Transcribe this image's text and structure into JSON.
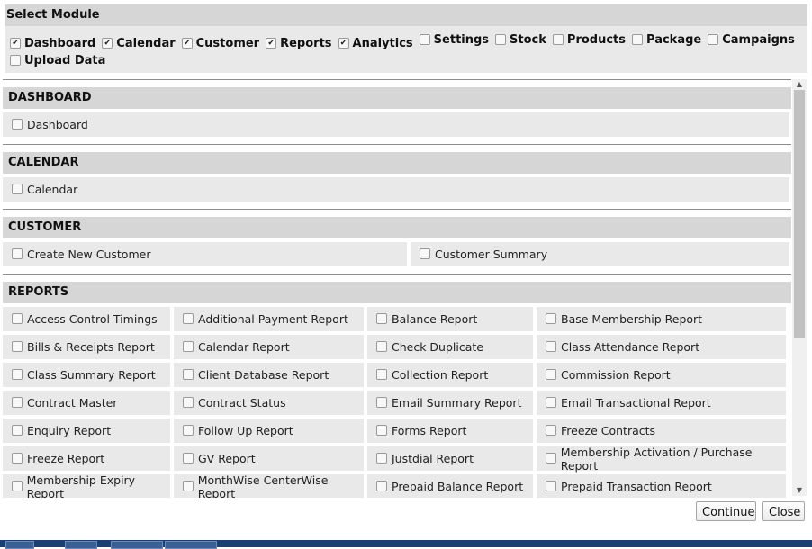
{
  "module_panel": {
    "title": "Select Module",
    "options": [
      {
        "label": "Dashboard",
        "checked": true
      },
      {
        "label": "Calendar",
        "checked": true
      },
      {
        "label": "Customer",
        "checked": true
      },
      {
        "label": "Reports",
        "checked": true
      },
      {
        "label": "Analytics",
        "checked": true
      },
      {
        "label": "Settings",
        "checked": false
      },
      {
        "label": "Stock",
        "checked": false
      },
      {
        "label": "Products",
        "checked": false
      },
      {
        "label": "Package",
        "checked": false
      },
      {
        "label": "Campaigns",
        "checked": false
      },
      {
        "label": "Upload Data",
        "checked": false
      }
    ]
  },
  "sections": {
    "dashboard": {
      "title": "DASHBOARD",
      "items": [
        "Dashboard"
      ]
    },
    "calendar": {
      "title": "CALENDAR",
      "items": [
        "Calendar"
      ]
    },
    "customer": {
      "title": "CUSTOMER",
      "items": [
        "Create New Customer",
        "Customer Summary"
      ]
    },
    "reports": {
      "title": "REPORTS",
      "items": [
        "Access Control Timings",
        "Additional Payment Report",
        "Balance Report",
        "Base Membership Report",
        "Bills & Receipts Report",
        "Calendar Report",
        "Check Duplicate",
        "Class Attendance Report",
        "Class Summary Report",
        "Client Database Report",
        "Collection Report",
        "Commission Report",
        "Contract Master",
        "Contract Status",
        "Email Summary Report",
        "Email Transactional Report",
        "Enquiry Report",
        "Follow Up Report",
        "Forms Report",
        "Freeze Contracts",
        "Freeze Report",
        "GV Report",
        "Justdial Report",
        "Membership Activation / Purchase Report",
        "Membership Expiry Report",
        "MonthWise CenterWise Report",
        "Prepaid Balance Report",
        "Prepaid Transaction Report"
      ]
    }
  },
  "footer": {
    "continue_label": "Continue",
    "close_label": "Close"
  },
  "icons": {
    "checkbox_checked": "checkmark-icon",
    "scroll_up": "scroll-up-arrow-icon",
    "scroll_down": "scroll-down-arrow-icon"
  }
}
